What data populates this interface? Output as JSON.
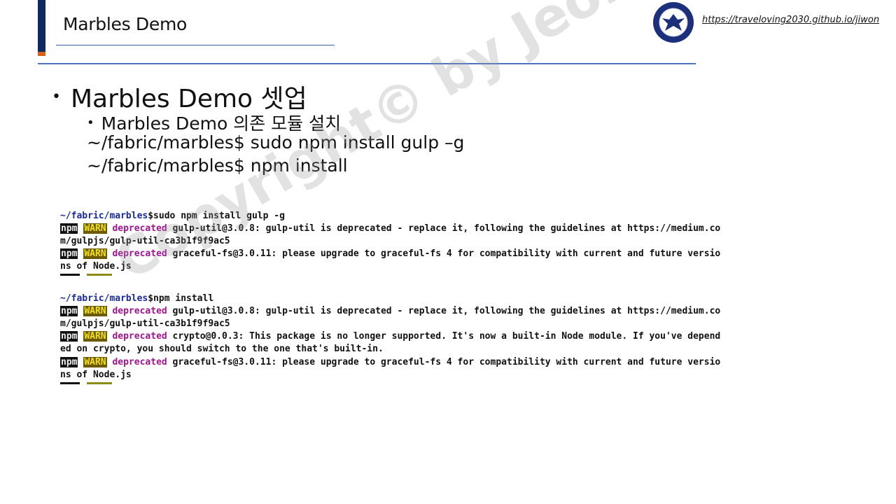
{
  "header": {
    "title": "Marbles Demo",
    "site_link": "https://traveloving2030.github.io/jiwon"
  },
  "content": {
    "main_bullet": "Marbles Demo 셋업",
    "sub_bullet": "Marbles Demo 의존 모듈 설치",
    "commands": [
      "~/fabric/marbles$ sudo npm install gulp –g",
      "~/fabric/marbles$ npm install"
    ]
  },
  "terminal": {
    "block1_prompt_path": "~/fabric/marbles",
    "block1_prompt_cmd": "$sudo npm install gulp -g",
    "block2_prompt_path": "~/fabric/marbles",
    "block2_prompt_cmd": "$npm install",
    "npm_tag": "npm",
    "warn_tag": "WARN",
    "deprecated": "deprecated",
    "w1": " gulp-util@3.0.8: gulp-util is deprecated - replace it, following the guidelines at https://medium.co",
    "w1_cont": "m/gulpjs/gulp-util-ca3b1f9f9ac5",
    "w2": " graceful-fs@3.0.11: please upgrade to graceful-fs 4 for compatibility with current and future versio",
    "w2_cont": "ns of Node.js",
    "w3": " gulp-util@3.0.8: gulp-util is deprecated - replace it, following the guidelines at https://medium.co",
    "w3_cont": "m/gulpjs/gulp-util-ca3b1f9f9ac5",
    "w4": " crypto@0.0.3: This package is no longer supported. It's now a built-in Node module. If you've depend",
    "w4_cont": "ed on crypto, you should switch to the one that's built-in.",
    "w5": " graceful-fs@3.0.11: please upgrade to graceful-fs 4 for compatibility with current and future versio",
    "w5_cont": "ns of Node.js"
  },
  "watermark": "Copyright© by Jeong JiWon",
  "colors": {
    "accent_navy": "#0e2a5e",
    "accent_orange": "#d7621b",
    "rule_blue": "#4f73c4",
    "terminal_path": "#1a2a9a",
    "terminal_deprecated": "#a0158f",
    "terminal_warn_bg": "#6b5a00"
  }
}
